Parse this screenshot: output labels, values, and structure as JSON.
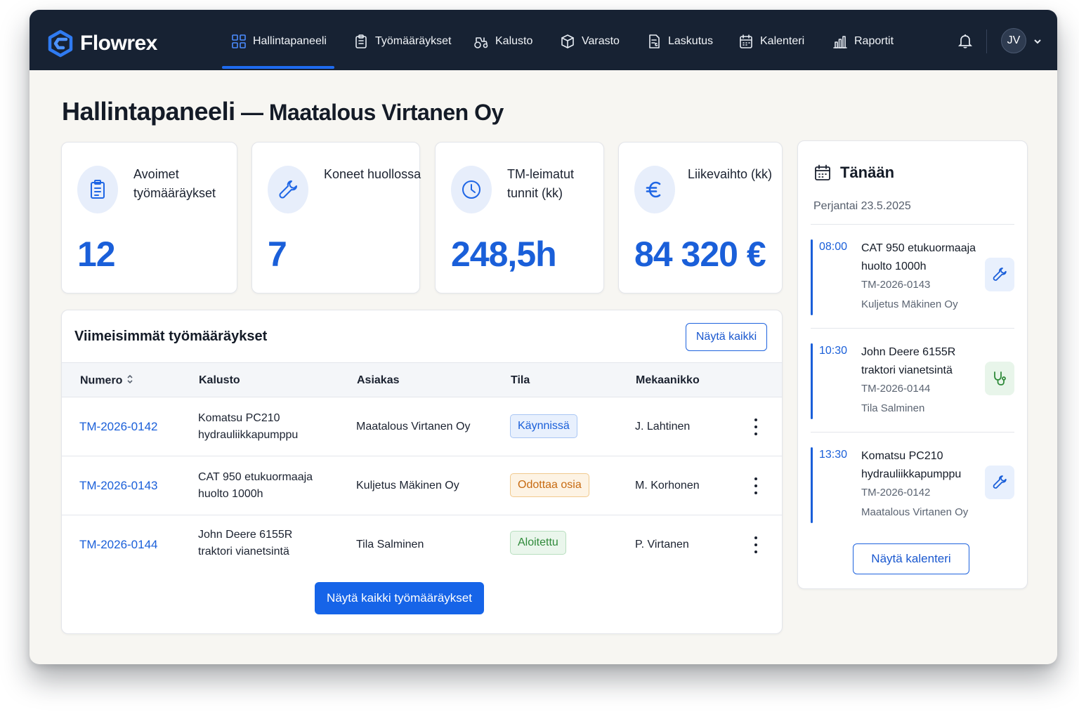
{
  "app": {
    "name": "Flowrex"
  },
  "nav": {
    "items": [
      {
        "label": "Hallintapaneeli",
        "icon": "grid-icon",
        "active": true
      },
      {
        "label": "Työmääräykset",
        "icon": "clipboard-icon"
      },
      {
        "label": "Kalusto",
        "icon": "tractor-icon"
      },
      {
        "label": "Varasto",
        "icon": "box-icon"
      },
      {
        "label": "Laskutus",
        "icon": "invoice-icon"
      },
      {
        "label": "Kalenteri",
        "icon": "calendar-icon"
      },
      {
        "label": "Raportit",
        "icon": "bar-chart-icon"
      }
    ],
    "user_initials": "JV"
  },
  "page": {
    "title": "Hallintapaneeli",
    "separator": " — ",
    "company": "Maatalous Virtanen Oy"
  },
  "kpis": [
    {
      "label": "Avoimet työmääräykset",
      "value": "12",
      "icon": "clipboard-icon"
    },
    {
      "label": "Koneet huollossa",
      "value": "7",
      "icon": "wrench-icon"
    },
    {
      "label": "TM-leimatut tunnit (kk)",
      "value": "248,5h",
      "icon": "clock-icon"
    },
    {
      "label": "Liikevaihto (kk)",
      "value": "84 320 €",
      "icon": "euro-icon"
    }
  ],
  "work_orders": {
    "title": "Viimeisimmät työmääräykset",
    "show_all_label": "Näytä kaikki",
    "columns": [
      "Numero",
      "Kalusto",
      "Asiakas",
      "Tila",
      "Mekaanikko"
    ],
    "rows": [
      {
        "number": "TM-2026-0142",
        "equipment_1": "Komatsu PC210",
        "equipment_2": "hydrauliikkapumppu",
        "customer": "Maatalous Virtanen Oy",
        "status": "Käynnissä",
        "status_color": "#1a5fd9",
        "mechanic": "J. Lahtinen"
      },
      {
        "number": "TM-2026-0143",
        "equipment_1": "CAT 950 etukuormaaja",
        "equipment_2": "huolto 1000h",
        "customer": "Kuljetus Mäkinen Oy",
        "status": "Odottaa osia",
        "status_color": "#c76a10",
        "mechanic": "M. Korhonen"
      },
      {
        "number": "TM-2026-0144",
        "equipment_1": "John Deere 6155R",
        "equipment_2": "traktori vianetsintä",
        "customer": "Tila Salminen",
        "status": "Aloitettu",
        "status_color": "#2f8a3a",
        "mechanic": "P. Virtanen"
      }
    ],
    "primary_button_label": "Näytä kaikki työmääräykset"
  },
  "today": {
    "title": "Tänään",
    "date": "Perjantai 23.5.2025",
    "events": [
      {
        "time": "08:00",
        "title": "CAT 950 etukuormaaja huolto 1000h",
        "code": "TM-2026-0143",
        "customer": "Kuljetus Mäkinen Oy",
        "icon": "wrench-icon"
      },
      {
        "time": "10:30",
        "title": "John Deere 6155R traktori vianetsintä",
        "code": "TM-2026-0144",
        "customer": "Tila Salminen",
        "icon": "stethoscope-icon"
      },
      {
        "time": "13:30",
        "title": "Komatsu PC210 hydrauliikkapumppu",
        "code": "TM-2026-0142",
        "customer": "Maatalous Virtanen Oy",
        "icon": "wrench-icon"
      }
    ],
    "calendar_button_label": "Näytä kalenteri"
  },
  "colors": {
    "nav_bg": "#172233",
    "accent": "#1a5fd9",
    "page_bg": "#f7f6f2"
  }
}
